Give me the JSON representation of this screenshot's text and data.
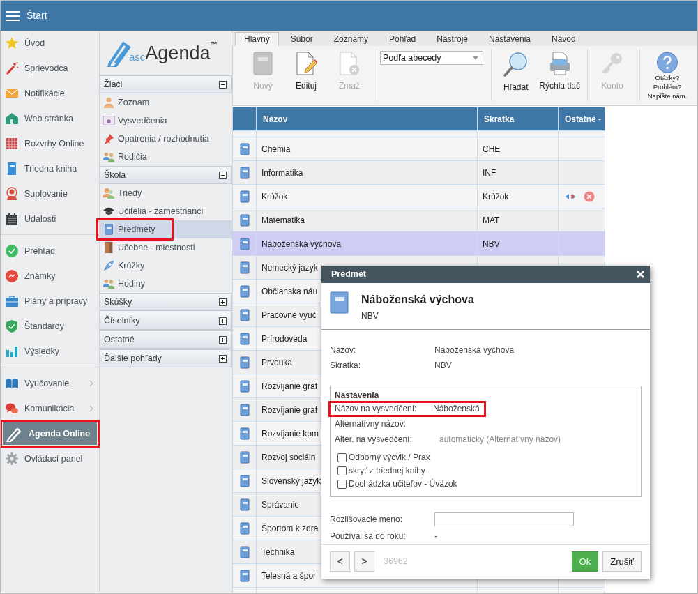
{
  "topbar": {
    "title": "Štart"
  },
  "sidebar": {
    "groups": [
      [
        {
          "label": "Úvod",
          "selected": false,
          "highlighted": false,
          "has_submenu": false
        },
        {
          "label": "Sprievodca",
          "selected": false,
          "highlighted": false,
          "has_submenu": false
        },
        {
          "label": "Notifikácie",
          "selected": false,
          "highlighted": false,
          "has_submenu": false
        },
        {
          "label": "Web stránka",
          "selected": false,
          "highlighted": false,
          "has_submenu": false
        },
        {
          "label": "Rozvrhy Online",
          "selected": false,
          "highlighted": false,
          "has_submenu": false
        },
        {
          "label": "Triedna kniha",
          "selected": false,
          "highlighted": false,
          "has_submenu": false
        },
        {
          "label": "Suplovanie",
          "selected": false,
          "highlighted": false,
          "has_submenu": false
        },
        {
          "label": "Udalosti",
          "selected": false,
          "highlighted": false,
          "has_submenu": false
        }
      ],
      [
        {
          "label": "Prehľad",
          "selected": false,
          "highlighted": false,
          "has_submenu": false
        },
        {
          "label": "Známky",
          "selected": false,
          "highlighted": false,
          "has_submenu": false
        },
        {
          "label": "Plány a prípravy",
          "selected": false,
          "highlighted": false,
          "has_submenu": false
        },
        {
          "label": "Štandardy",
          "selected": false,
          "highlighted": false,
          "has_submenu": false
        },
        {
          "label": "Výsledky",
          "selected": false,
          "highlighted": false,
          "has_submenu": false
        }
      ],
      [
        {
          "label": "Vyučovanie",
          "selected": false,
          "highlighted": false,
          "has_submenu": true
        },
        {
          "label": "Komunikácia",
          "selected": false,
          "highlighted": false,
          "has_submenu": true
        },
        {
          "label": "Agenda Online",
          "selected": true,
          "highlighted": true,
          "has_submenu": false
        },
        {
          "label": "Ovládací panel",
          "selected": false,
          "highlighted": false,
          "has_submenu": false
        }
      ]
    ]
  },
  "agenda_nav": {
    "logo": {
      "prefix": "asc",
      "name": "Agenda",
      "mark": "™"
    },
    "sections": [
      {
        "title": "Žiaci",
        "expanded": true,
        "items": [
          {
            "label": "Zoznam",
            "selected": false,
            "highlighted": false
          },
          {
            "label": "Vysvedčenia",
            "selected": false,
            "highlighted": false
          },
          {
            "label": "Opatrenia / rozhodnutia",
            "selected": false,
            "highlighted": false
          },
          {
            "label": "Rodičia",
            "selected": false,
            "highlighted": false
          }
        ]
      },
      {
        "title": "Škola",
        "expanded": true,
        "items": [
          {
            "label": "Triedy",
            "selected": false,
            "highlighted": false
          },
          {
            "label": "Učitelia - zamestnanci",
            "selected": false,
            "highlighted": false
          },
          {
            "label": "Predmety",
            "selected": true,
            "highlighted": true
          },
          {
            "label": "Učebne - miestnosti",
            "selected": false,
            "highlighted": false
          },
          {
            "label": "Krúžky",
            "selected": false,
            "highlighted": false
          },
          {
            "label": "Hodiny",
            "selected": false,
            "highlighted": false
          }
        ]
      },
      {
        "title": "Skúšky",
        "expanded": false
      },
      {
        "title": "Číselníky",
        "expanded": false
      },
      {
        "title": "Ostatné",
        "expanded": false
      },
      {
        "title": "Ďalšie pohľady",
        "expanded": false
      }
    ]
  },
  "ribbon": {
    "tabs": [
      {
        "label": "Hlavný",
        "selected": true
      },
      {
        "label": "Súbor",
        "selected": false
      },
      {
        "label": "Zoznamy",
        "selected": false
      },
      {
        "label": "Pohľad",
        "selected": false
      },
      {
        "label": "Nástroje",
        "selected": false
      },
      {
        "label": "Nastavenia",
        "selected": false
      },
      {
        "label": "Návod",
        "selected": false
      }
    ],
    "groups": [
      {
        "kind": "buttons",
        "buttons": [
          {
            "label": "Nový",
            "disabled": true
          },
          {
            "label": "Edituj",
            "disabled": false
          },
          {
            "label": "Zmaž",
            "disabled": true
          }
        ]
      },
      {
        "kind": "dropdown",
        "value": "Podľa abecedy"
      },
      {
        "kind": "buttons",
        "buttons": [
          {
            "label": "Hľadať",
            "disabled": false
          },
          {
            "label": "Rýchla tlač",
            "disabled": false
          }
        ]
      },
      {
        "kind": "buttons",
        "buttons": [
          {
            "label": "Konto",
            "disabled": true
          }
        ]
      },
      {
        "kind": "help",
        "lines": [
          "Otázky?",
          "Problém?",
          "Napíšte nám."
        ]
      }
    ]
  },
  "table": {
    "columns": [
      "Názov",
      "Skratka",
      "Ostatné -"
    ],
    "rows": [
      {
        "name": "Chémia",
        "abbr": "CHE",
        "selected": false,
        "actions": false
      },
      {
        "name": "Informatika",
        "abbr": "INF",
        "selected": false,
        "actions": false
      },
      {
        "name": "Krúžok",
        "abbr": "Krúžok",
        "selected": false,
        "actions": true
      },
      {
        "name": "Matematika",
        "abbr": "MAT",
        "selected": false,
        "actions": false
      },
      {
        "name": "Náboženská výchova",
        "abbr": "NBV",
        "selected": true,
        "actions": false
      },
      {
        "name": "Nemecký jazyk",
        "selected": false,
        "actions": false
      },
      {
        "name": "Občianska náu",
        "selected": false
      },
      {
        "name": "Pracovné vyuč",
        "selected": false
      },
      {
        "name": "Prírodoveda",
        "selected": false
      },
      {
        "name": "Prvouka",
        "selected": false
      },
      {
        "name": "Rozvíjanie graf",
        "selected": false
      },
      {
        "name": "Rozvíjanie graf",
        "selected": false
      },
      {
        "name": "Rozvíjanie kom",
        "selected": false
      },
      {
        "name": "Rozvoj sociáln",
        "selected": false
      },
      {
        "name": "Slovenský jazyk",
        "selected": false
      },
      {
        "name": "Správanie",
        "selected": false
      },
      {
        "name": "Športom k zdra",
        "selected": false
      },
      {
        "name": "Technika",
        "selected": false
      },
      {
        "name": "Telesná a špor",
        "selected": false
      }
    ]
  },
  "dialog": {
    "title": "Predmet",
    "name": "Náboženská výchova",
    "abbr": "NBV",
    "fields": [
      {
        "label": "Názov:",
        "value": "Náboženská výchova"
      },
      {
        "label": "Skratka:",
        "value": "NBV"
      }
    ],
    "settings": {
      "title": "Nastavenia",
      "rows": [
        {
          "label": "Názov na vysvedčení:",
          "value": "Náboženská",
          "highlighted": true
        },
        {
          "label": "Alternatívny názov:",
          "highlighted": false
        },
        {
          "label": "Alter. na vysvedčení:",
          "placeholder": "automaticky (Alternatívny názov)",
          "highlighted": false
        }
      ],
      "checkboxes": [
        {
          "label": "Odborný výcvik / Prax",
          "checked": false
        },
        {
          "label": "skryť z triednej knihy",
          "checked": false
        },
        {
          "label": "Dochádzka učiteľov - Úväzok",
          "checked": false
        }
      ]
    },
    "extra_fields": [
      {
        "kind": "input",
        "label": "Rozlišovacie meno:"
      },
      {
        "kind": "text",
        "label": "Používal sa do roku:",
        "value": "-"
      }
    ],
    "nav": [
      "<",
      ">"
    ],
    "record_number": "36962",
    "buttons": [
      {
        "label": "Ok",
        "kind": "primary"
      },
      {
        "label": "Zrušiť",
        "kind": "secondary"
      }
    ]
  }
}
